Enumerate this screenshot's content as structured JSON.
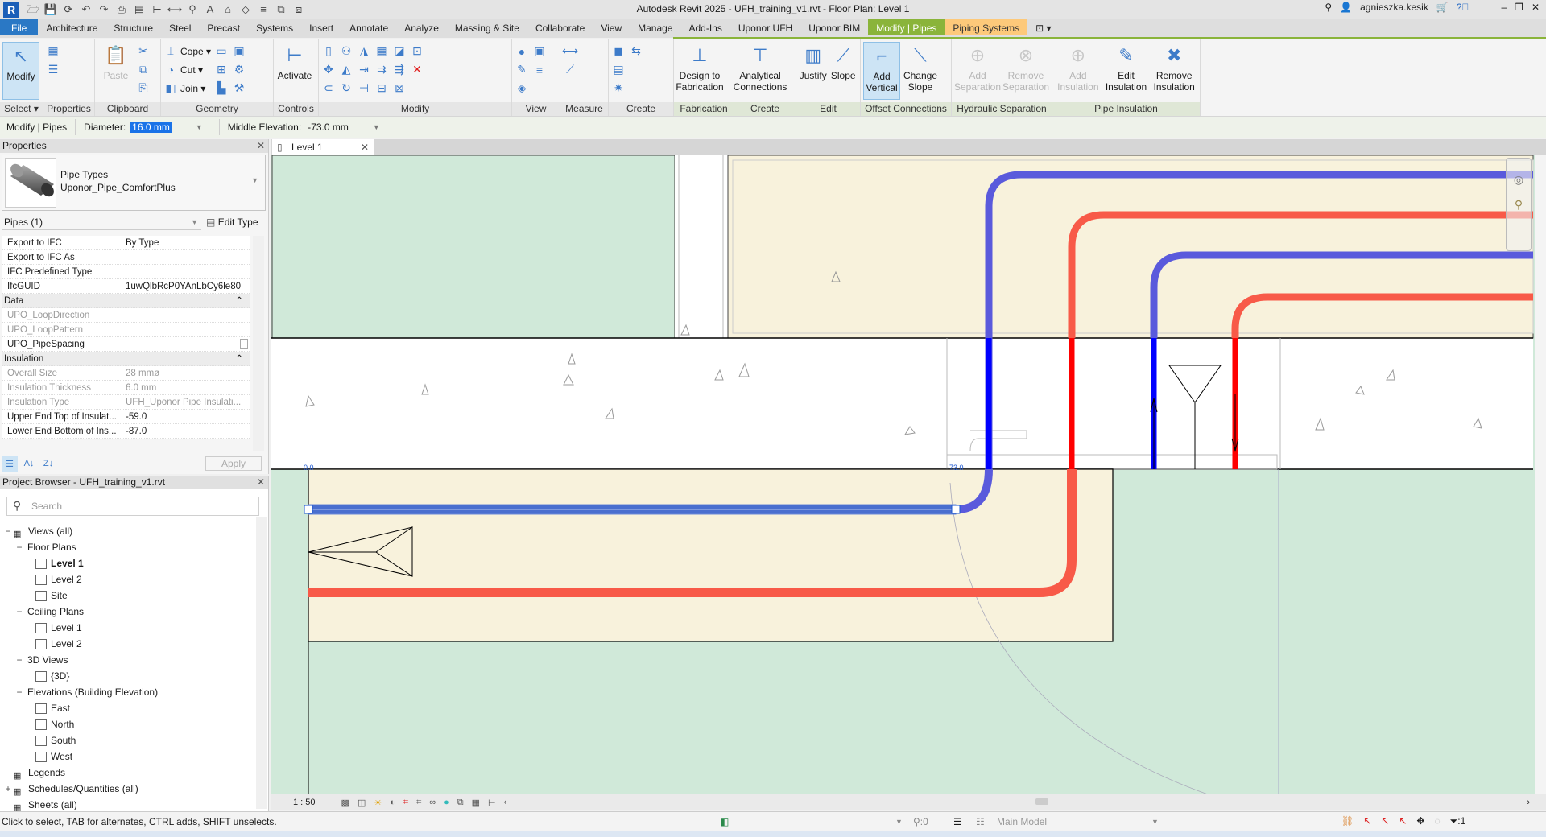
{
  "window": {
    "title": "Autodesk Revit 2025 - UFH_training_v1.rvt - Floor Plan: Level 1",
    "user": "agnieszka.kesik",
    "app_letter": "R"
  },
  "quick_access": [
    "open-icon",
    "save-icon",
    "sync-icon",
    "undo-icon",
    "redo-icon",
    "print-icon",
    "export-icon",
    "dimension-icon",
    "measure-icon",
    "tag-icon",
    "text-icon",
    "home-icon",
    "section-icon",
    "thin-lines-icon",
    "close-hidden-icon",
    "switch-windows-icon"
  ],
  "tabs": [
    {
      "label": "File",
      "kind": "file"
    },
    {
      "label": "Architecture"
    },
    {
      "label": "Structure"
    },
    {
      "label": "Steel"
    },
    {
      "label": "Precast"
    },
    {
      "label": "Systems"
    },
    {
      "label": "Insert"
    },
    {
      "label": "Annotate"
    },
    {
      "label": "Analyze"
    },
    {
      "label": "Massing & Site"
    },
    {
      "label": "Collaborate"
    },
    {
      "label": "View"
    },
    {
      "label": "Manage"
    },
    {
      "label": "Add-Ins"
    },
    {
      "label": "Uponor UFH"
    },
    {
      "label": "Uponor BIM"
    },
    {
      "label": "Modify | Pipes",
      "kind": "ctx"
    },
    {
      "label": "Piping Systems",
      "kind": "ctx2"
    }
  ],
  "ribbon": [
    {
      "label": "Select ▾",
      "width": 54,
      "large": [
        {
          "label": "Modify",
          "icon": "cursor-arrow-icon",
          "glyph": "↖",
          "active": true
        }
      ]
    },
    {
      "label": "Properties",
      "width": 64,
      "small": [
        {
          "icon": "type-properties-icon",
          "glyph": "▦"
        },
        {
          "icon": "properties-icon",
          "glyph": "☰"
        }
      ]
    },
    {
      "label": "Clipboard",
      "width": 82,
      "large": [
        {
          "label": "Paste",
          "icon": "paste-icon",
          "glyph": "📋",
          "disabled": true
        }
      ],
      "small": [
        {
          "icon": "cut-icon",
          "glyph": "✂"
        },
        {
          "icon": "copy-icon",
          "glyph": "⧉"
        },
        {
          "icon": "match-type-icon",
          "glyph": "⎘"
        }
      ]
    },
    {
      "label": "Geometry",
      "width": 140,
      "small": [
        {
          "label": "Cope ▾",
          "icon": "cope-icon",
          "glyph": "⌶"
        },
        {
          "label": "Cut ▾",
          "icon": "cut-geometry-icon",
          "glyph": "◔"
        },
        {
          "label": "Join ▾",
          "icon": "join-icon",
          "glyph": "◧"
        },
        {
          "icon": "uncut-icon",
          "glyph": "▭"
        },
        {
          "icon": "split-face-icon",
          "glyph": "⊞"
        },
        {
          "icon": "paint-icon",
          "glyph": "▙"
        },
        {
          "icon": "wall-joins-icon",
          "glyph": "▣"
        },
        {
          "icon": "settings-icon",
          "glyph": "⚙"
        },
        {
          "icon": "demolish-icon",
          "glyph": "⚒"
        }
      ]
    },
    {
      "label": "Controls",
      "width": 56,
      "large": [
        {
          "label": "Activate",
          "icon": "activate-controls-icon",
          "glyph": "⊢"
        }
      ]
    },
    {
      "label": "Modify",
      "width": 240,
      "small": [
        {
          "icon": "align-icon",
          "glyph": "▯"
        },
        {
          "icon": "move-icon",
          "glyph": "✥"
        },
        {
          "icon": "offset-icon",
          "glyph": "⊂"
        },
        {
          "icon": "copy-element-icon",
          "glyph": "⚇"
        },
        {
          "icon": "mirror-pick-icon",
          "glyph": "◭"
        },
        {
          "icon": "rotate-icon",
          "glyph": "↻"
        },
        {
          "icon": "mirror-draw-icon",
          "glyph": "◮"
        },
        {
          "icon": "trim-extend-icon",
          "glyph": "⇥"
        },
        {
          "icon": "split-icon",
          "glyph": "⊣"
        },
        {
          "icon": "array-icon",
          "glyph": "▦"
        },
        {
          "icon": "trim-multiple-icon",
          "glyph": "⇉"
        },
        {
          "icon": "split-gap-icon",
          "glyph": "⊟"
        },
        {
          "icon": "scale-icon",
          "glyph": "◪"
        },
        {
          "icon": "trim-single-icon",
          "glyph": "⇶"
        },
        {
          "icon": "pin-icon",
          "glyph": "⊠"
        },
        {
          "icon": "unpin-icon",
          "glyph": "⊡"
        },
        {
          "icon": "delete-icon",
          "glyph": "✕",
          "color": "#e02020"
        }
      ]
    },
    {
      "label": "View",
      "width": 60,
      "small": [
        {
          "icon": "hide-icon",
          "glyph": "●"
        },
        {
          "icon": "override-icon",
          "glyph": "✎"
        },
        {
          "icon": "view-3d-icon",
          "glyph": "◈"
        },
        {
          "icon": "filter-icon",
          "glyph": "▣"
        },
        {
          "icon": "linework-icon",
          "glyph": "≡"
        }
      ]
    },
    {
      "label": "Measure",
      "width": 60,
      "small": [
        {
          "icon": "measure-distance-icon",
          "glyph": "⟷"
        },
        {
          "icon": "aligned-dimension-icon",
          "glyph": "⟋"
        }
      ]
    },
    {
      "label": "Create",
      "width": 81,
      "small": [
        {
          "icon": "create-assembly-icon",
          "glyph": "◼"
        },
        {
          "icon": "create-parts-icon",
          "glyph": "▤"
        },
        {
          "icon": "create-group-icon",
          "glyph": "✷"
        },
        {
          "icon": "create-similar-icon",
          "glyph": "⇆"
        }
      ]
    },
    {
      "label": "Fabrication",
      "width": 75,
      "ctx": true,
      "large": [
        {
          "label": "Design to Fabrication",
          "icon": "design-to-fabrication-icon",
          "glyph": "⊥",
          "wide": true
        }
      ]
    },
    {
      "label": "Create",
      "width": 77,
      "ctx": true,
      "large": [
        {
          "label": "Analytical Connections",
          "icon": "analytical-connections-icon",
          "glyph": "⊤",
          "wide": true
        }
      ]
    },
    {
      "label": "Edit",
      "width": 80,
      "ctx": true,
      "large": [
        {
          "label": "Justify",
          "icon": "justify-icon",
          "glyph": "▥"
        },
        {
          "label": "Slope",
          "icon": "slope-icon",
          "glyph": "⟋"
        }
      ]
    },
    {
      "label": "Offset Connections",
      "width": 113,
      "ctx": true,
      "large": [
        {
          "label": "Add Vertical",
          "icon": "add-vertical-icon",
          "glyph": "⌐",
          "active": true
        },
        {
          "label": "Change Slope",
          "icon": "change-slope-icon",
          "glyph": "⟍"
        }
      ]
    },
    {
      "label": "Hydraulic Separation",
      "width": 125,
      "ctx": true,
      "large": [
        {
          "label": "Add Separation",
          "icon": "add-separation-icon",
          "glyph": "⊕",
          "disabled": true,
          "wide": true
        },
        {
          "label": "Remove Separation",
          "icon": "remove-separation-icon",
          "glyph": "⊗",
          "disabled": true,
          "wide": true
        }
      ]
    },
    {
      "label": "Pipe Insulation",
      "width": 184,
      "ctx": true,
      "large": [
        {
          "label": "Add Insulation",
          "icon": "add-insulation-icon",
          "glyph": "⊕",
          "disabled": true,
          "wide": true
        },
        {
          "label": "Edit Insulation",
          "icon": "edit-insulation-icon",
          "glyph": "✎",
          "wide": true
        },
        {
          "label": "Remove Insulation",
          "icon": "remove-insulation-icon",
          "glyph": "✖",
          "wide": true
        }
      ]
    }
  ],
  "options_bar": {
    "context": "Modify | Pipes",
    "diameter_label": "Diameter:",
    "diameter_value": "16.0 mm",
    "elevation_label": "Middle Elevation:",
    "elevation_value": "-73.0 mm"
  },
  "properties": {
    "title": "Properties",
    "type_family": "Pipe Types",
    "type_name": "Uponor_Pipe_ComfortPlus",
    "selection": "Pipes (1)",
    "edit_type": "Edit Type",
    "apply": "Apply",
    "rows": [
      {
        "name": "Export to IFC",
        "value": "By Type"
      },
      {
        "name": "Export to IFC As",
        "value": ""
      },
      {
        "name": "IFC Predefined Type",
        "value": ""
      },
      {
        "name": "IfcGUID",
        "value": "1uwQlbRcP0YAnLbCy6le80"
      },
      {
        "name": "Data",
        "header": true
      },
      {
        "name": "UPO_LoopDirection",
        "value": "",
        "readonly": true
      },
      {
        "name": "UPO_LoopPattern",
        "value": "",
        "readonly": true
      },
      {
        "name": "UPO_PipeSpacing",
        "value": "",
        "checkbox": true
      },
      {
        "name": "Insulation",
        "header": true
      },
      {
        "name": "Overall Size",
        "value": "28 mmø",
        "readonly": true
      },
      {
        "name": "Insulation Thickness",
        "value": "6.0 mm",
        "readonly": true
      },
      {
        "name": "Insulation Type",
        "value": "UFH_Uponor Pipe Insulati...",
        "readonly": true
      },
      {
        "name": "Upper End Top of Insulat...",
        "value": "-59.0"
      },
      {
        "name": "Lower End Bottom of Ins...",
        "value": "-87.0"
      }
    ]
  },
  "browser": {
    "title": "Project Browser - UFH_training_v1.rvt",
    "search_placeholder": "Search",
    "items": [
      {
        "label": "Views (all)",
        "level": 0,
        "toggle": "−",
        "icon": "views-icon"
      },
      {
        "label": "Floor Plans",
        "level": 1,
        "toggle": "−"
      },
      {
        "label": "Level 1",
        "level": 2,
        "icon": "view-icon",
        "bold": true
      },
      {
        "label": "Level 2",
        "level": 2,
        "icon": "view-icon"
      },
      {
        "label": "Site",
        "level": 2,
        "icon": "view-icon"
      },
      {
        "label": "Ceiling Plans",
        "level": 1,
        "toggle": "−"
      },
      {
        "label": "Level 1",
        "level": 2,
        "icon": "view-icon"
      },
      {
        "label": "Level 2",
        "level": 2,
        "icon": "view-icon"
      },
      {
        "label": "3D Views",
        "level": 1,
        "toggle": "−"
      },
      {
        "label": "{3D}",
        "level": 2,
        "icon": "view-icon"
      },
      {
        "label": "Elevations (Building Elevation)",
        "level": 1,
        "toggle": "−"
      },
      {
        "label": "East",
        "level": 2,
        "icon": "view-icon"
      },
      {
        "label": "North",
        "level": 2,
        "icon": "view-icon"
      },
      {
        "label": "South",
        "level": 2,
        "icon": "view-icon"
      },
      {
        "label": "West",
        "level": 2,
        "icon": "view-icon"
      },
      {
        "label": "Legends",
        "level": 0,
        "icon": "legends-icon"
      },
      {
        "label": "Schedules/Quantities (all)",
        "level": 0,
        "toggle": "+",
        "icon": "schedules-icon"
      },
      {
        "label": "Sheets (all)",
        "level": 0,
        "icon": "sheets-icon"
      }
    ]
  },
  "view": {
    "tab": "Level 1",
    "scale": "1 : 50",
    "start_elevation": "0.0",
    "end_elevation": "-73.0"
  },
  "colors": {
    "supply_pipe": "#f85a48",
    "return_pipe": "#5a5adc",
    "supply_in_wall": "#ff0000",
    "return_in_wall": "#0000ff",
    "room_green": "#d0e9d9",
    "room_beige": "#f8f2dc",
    "selection": "#4a6fcf"
  },
  "status": {
    "hint": "Click to select, TAB for alternates, CTRL adds, SHIFT unselects.",
    "worksets": ":0",
    "model": "Main Model",
    "filter_count": ":1"
  }
}
